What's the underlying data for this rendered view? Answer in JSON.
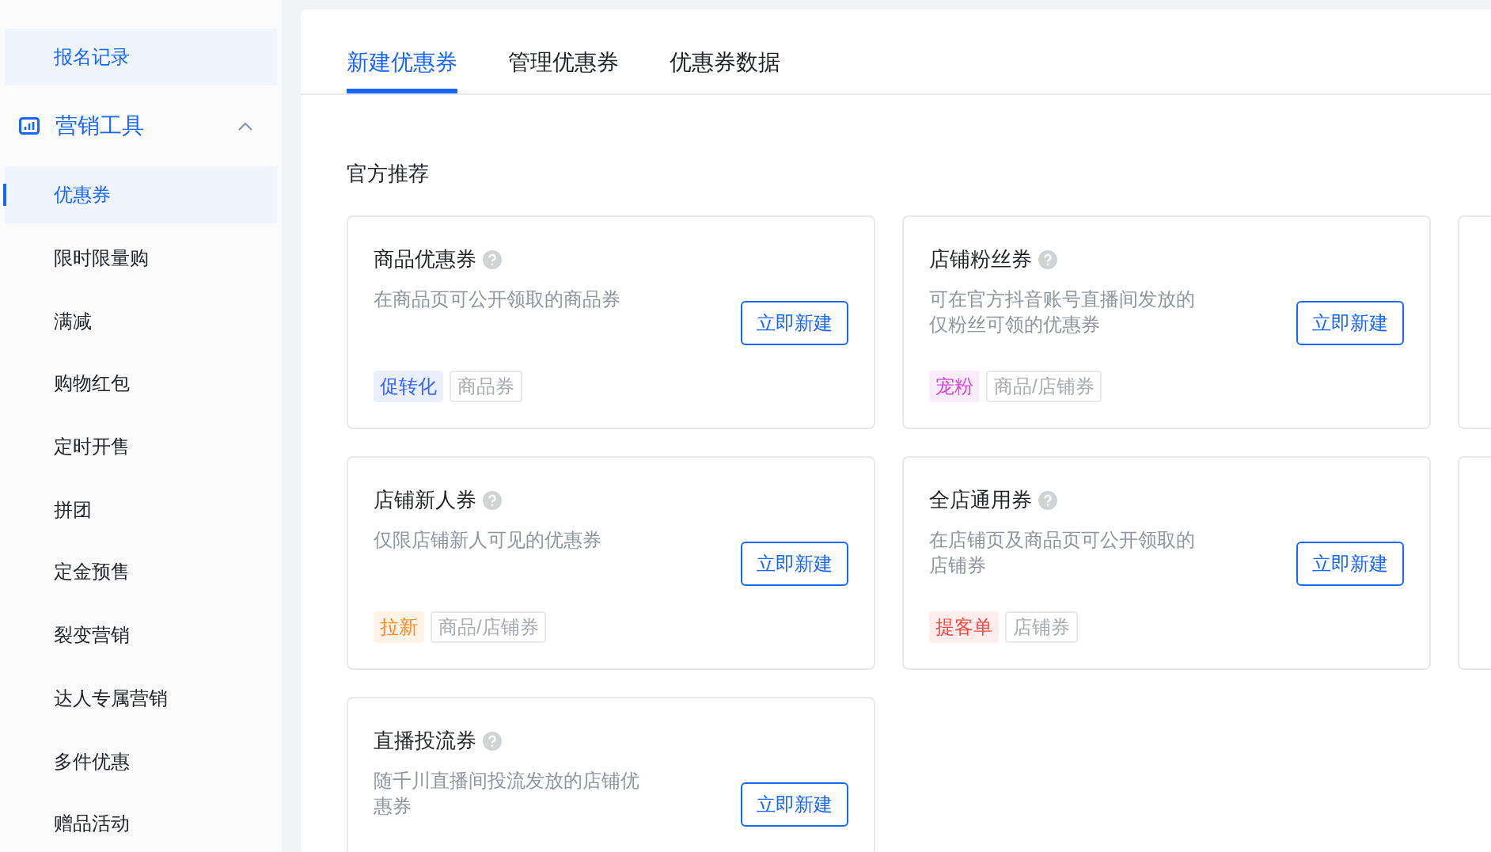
{
  "sidebar": {
    "items": [
      {
        "kind": "item",
        "label": "报名记录",
        "selected": false,
        "highlighted": true
      },
      {
        "kind": "group",
        "label": "营销工具",
        "expanded": true
      },
      {
        "kind": "item",
        "label": "优惠券",
        "selected": true,
        "highlighted": true
      },
      {
        "kind": "item",
        "label": "限时限量购",
        "selected": false,
        "highlighted": false
      },
      {
        "kind": "item",
        "label": "满减",
        "selected": false,
        "highlighted": false
      },
      {
        "kind": "item",
        "label": "购物红包",
        "selected": false,
        "highlighted": false
      },
      {
        "kind": "item",
        "label": "定时开售",
        "selected": false,
        "highlighted": false
      },
      {
        "kind": "item",
        "label": "拼团",
        "selected": false,
        "highlighted": false
      },
      {
        "kind": "item",
        "label": "定金预售",
        "selected": false,
        "highlighted": false
      },
      {
        "kind": "item",
        "label": "裂变营销",
        "selected": false,
        "highlighted": false
      },
      {
        "kind": "item",
        "label": "达人专属营销",
        "selected": false,
        "highlighted": false
      },
      {
        "kind": "item",
        "label": "多件优惠",
        "selected": false,
        "highlighted": false
      },
      {
        "kind": "item",
        "label": "赠品活动",
        "selected": false,
        "highlighted": false
      }
    ]
  },
  "tabs": [
    {
      "label": "新建优惠券",
      "selected": true
    },
    {
      "label": "管理优惠券",
      "selected": false
    },
    {
      "label": "优惠券数据",
      "selected": false
    }
  ],
  "section_title": "官方推荐",
  "cards": [
    {
      "kind": "coupon",
      "title": "商品优惠券",
      "description": "在商品页可公开领取的商品券",
      "button": "立即新建",
      "tags": [
        {
          "kind": "accent",
          "label": "促转化",
          "color": "#3363ff"
        },
        {
          "kind": "plain",
          "label": "商品券"
        }
      ]
    },
    {
      "kind": "coupon",
      "title": "店铺粉丝券",
      "description": "可在官方抖音账号直播间发放的仅粉丝可领的优惠券",
      "button": "立即新建",
      "tags": [
        {
          "kind": "accent",
          "label": "宠粉",
          "color": "#d448d4"
        },
        {
          "kind": "plain",
          "label": "商品/店铺券"
        }
      ]
    },
    {
      "kind": "clipped"
    },
    {
      "kind": "coupon",
      "title": "店铺新人券",
      "description": "仅限店铺新人可见的优惠券",
      "button": "立即新建",
      "tags": [
        {
          "kind": "accent",
          "label": "拉新",
          "color": "#ff8a1f"
        },
        {
          "kind": "plain",
          "label": "商品/店铺券"
        }
      ]
    },
    {
      "kind": "coupon",
      "title": "全店通用券",
      "description": "在店铺页及商品页可公开领取的店铺券",
      "button": "立即新建",
      "tags": [
        {
          "kind": "accent",
          "label": "提客单",
          "color": "#f54a45"
        },
        {
          "kind": "plain",
          "label": "店铺券"
        }
      ]
    },
    {
      "kind": "clipped"
    },
    {
      "kind": "coupon",
      "title": "直播投流券",
      "description": "随千川直播间投流发放的店铺优惠券",
      "button": "立即新建"
    }
  ]
}
